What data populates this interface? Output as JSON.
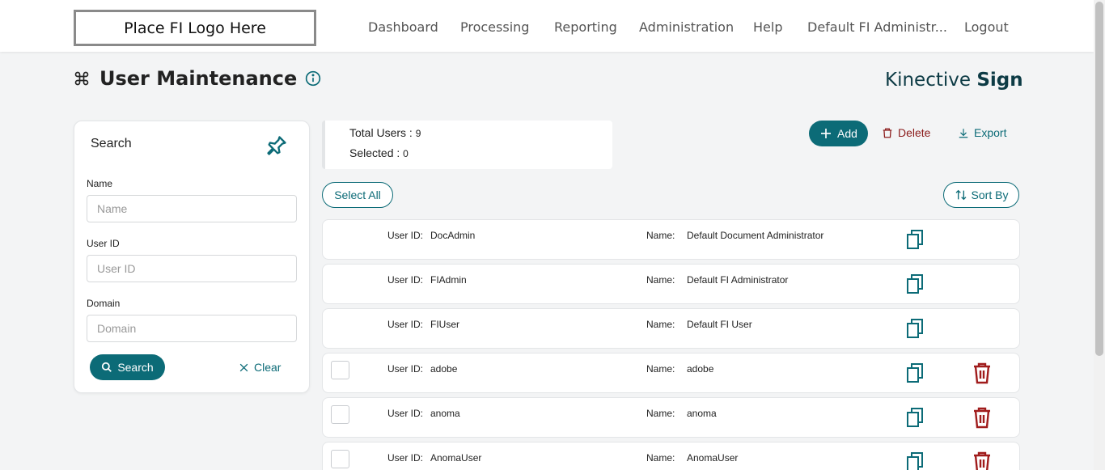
{
  "header": {
    "logo_text": "Place FI Logo Here",
    "nav": [
      {
        "label": "Dashboard"
      },
      {
        "label": "Processing"
      },
      {
        "label": "Reporting"
      },
      {
        "label": "Administration"
      },
      {
        "label": "Help"
      },
      {
        "label": "Default FI Administr..."
      },
      {
        "label": "Logout"
      }
    ]
  },
  "page": {
    "title": "User Maintenance",
    "title_icon": "command-icon",
    "info_icon": "info-icon",
    "brand_light": "Kinective",
    "brand_bold": "Sign"
  },
  "search": {
    "title": "Search",
    "pin_icon": "pin-icon",
    "name_label": "Name",
    "name_placeholder": "Name",
    "userid_label": "User ID",
    "userid_placeholder": "User ID",
    "domain_label": "Domain",
    "domain_placeholder": "Domain",
    "search_button": "Search",
    "clear_button": "Clear"
  },
  "totals": {
    "total_label": "Total Users : ",
    "total_value": "9",
    "selected_label": "Selected : ",
    "selected_value": "0"
  },
  "actions": {
    "add": "Add",
    "delete": "Delete",
    "export": "Export",
    "select_all": "Select All",
    "sort_by": "Sort By"
  },
  "users": {
    "uid_label": "User ID:",
    "name_label": "Name:",
    "rows": [
      {
        "user_id": "DocAdmin",
        "name": "Default Document Administrator",
        "selectable": false
      },
      {
        "user_id": "FIAdmin",
        "name": "Default FI Administrator",
        "selectable": false
      },
      {
        "user_id": "FIUser",
        "name": "Default FI User",
        "selectable": false
      },
      {
        "user_id": "adobe",
        "name": "adobe",
        "selectable": true
      },
      {
        "user_id": "anoma",
        "name": "anoma",
        "selectable": true
      },
      {
        "user_id": "AnomaUser",
        "name": "AnomaUser",
        "selectable": true
      }
    ]
  },
  "colors": {
    "accent": "#0c6b77",
    "danger": "#8b1b1b",
    "brand": "#0d3b45"
  }
}
